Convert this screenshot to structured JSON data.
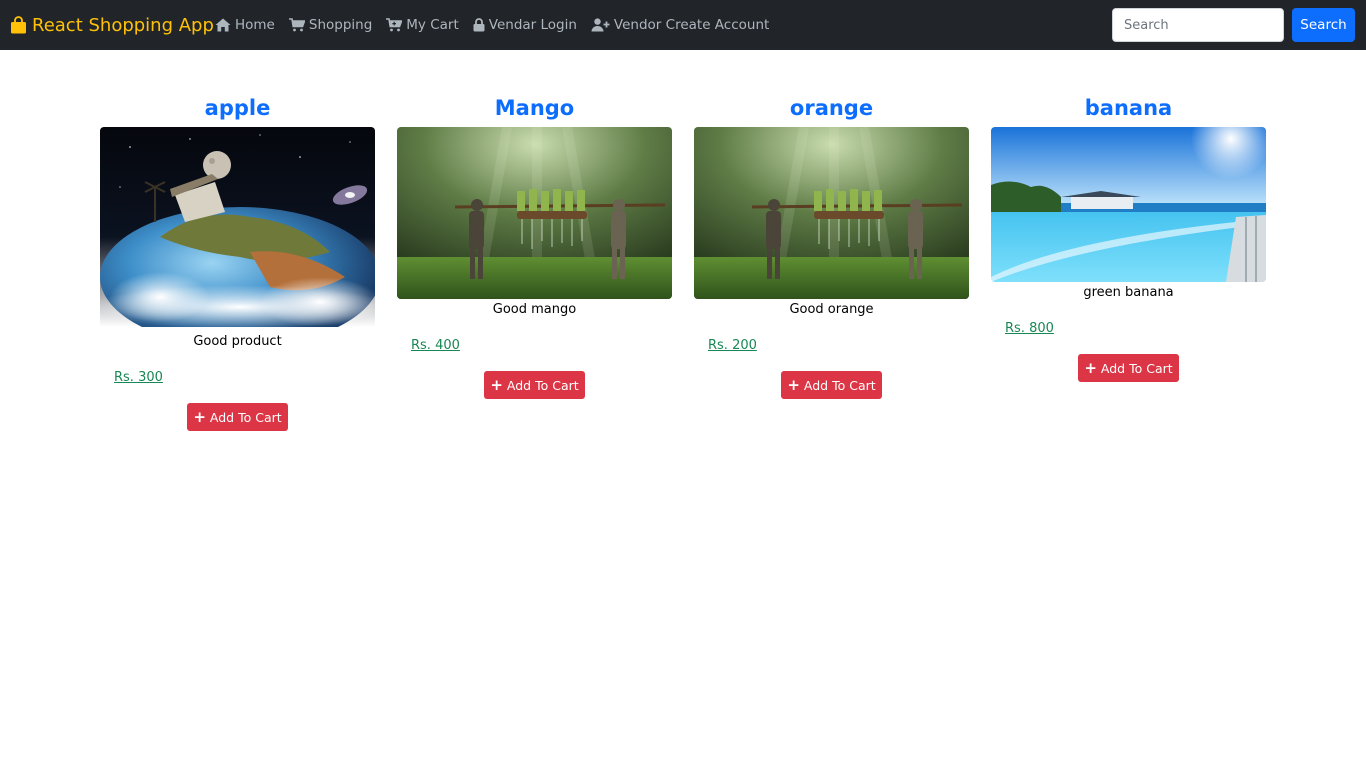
{
  "nav": {
    "brand": "React Shopping App",
    "links": [
      {
        "label": "Home",
        "icon": "home-icon"
      },
      {
        "label": "Shopping",
        "icon": "shopping-cart-icon"
      },
      {
        "label": "My Cart",
        "icon": "cart-icon"
      },
      {
        "label": "Vendar Login",
        "icon": "lock-icon"
      },
      {
        "label": "Vendor Create Account",
        "icon": "user-plus-icon"
      }
    ],
    "search_placeholder": "Search",
    "search_button": "Search"
  },
  "colors": {
    "navbar_bg": "#212529",
    "brand": "#ffc107",
    "title": "#0d6efd",
    "price": "#198754",
    "add_button": "#dc3545",
    "search_button": "#0d6efd"
  },
  "products": [
    {
      "name": "apple",
      "description": "Good product",
      "price": "Rs. 300",
      "image": "earth-island-fantasy-image",
      "button": "Add To Cart"
    },
    {
      "name": "Mango",
      "description": "Good mango",
      "price": "Rs. 400",
      "image": "rice-field-workers-image",
      "button": "Add To Cart"
    },
    {
      "name": "orange",
      "description": "Good orange",
      "price": "Rs. 200",
      "image": "rice-field-workers-image",
      "button": "Add To Cart"
    },
    {
      "name": "banana",
      "description": "green banana",
      "price": "Rs. 800",
      "image": "infinity-pool-sea-image",
      "button": "Add To Cart"
    }
  ]
}
